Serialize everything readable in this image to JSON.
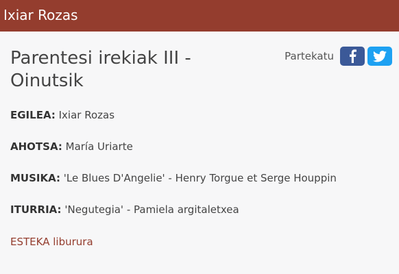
{
  "header": {
    "site_title": "Ixiar Rozas"
  },
  "page": {
    "title": "Parentesi irekiak III - Oinutsik"
  },
  "share": {
    "label": "Partekatu",
    "buttons": [
      {
        "name": "facebook",
        "icon": "facebook-icon",
        "color": "#3b5998"
      },
      {
        "name": "twitter",
        "icon": "twitter-icon",
        "color": "#1da1f2"
      }
    ]
  },
  "details": [
    {
      "key": "EGILEA:",
      "value": "Ixiar Rozas"
    },
    {
      "key": "AHOTSA:",
      "value": "María Uriarte"
    },
    {
      "key": "MUSIKA:",
      "value": "'Le Blues D'Angelie' - Henry Torgue et Serge Houppin"
    },
    {
      "key": "ITURRIA:",
      "value": "'Negutegia' - Pamiela argitaletxea"
    }
  ],
  "link": {
    "label": "ESTEKA liburura"
  },
  "colors": {
    "header_bg": "#943d2e",
    "link": "#943d2e",
    "page_bg": "#f7f7f8"
  }
}
